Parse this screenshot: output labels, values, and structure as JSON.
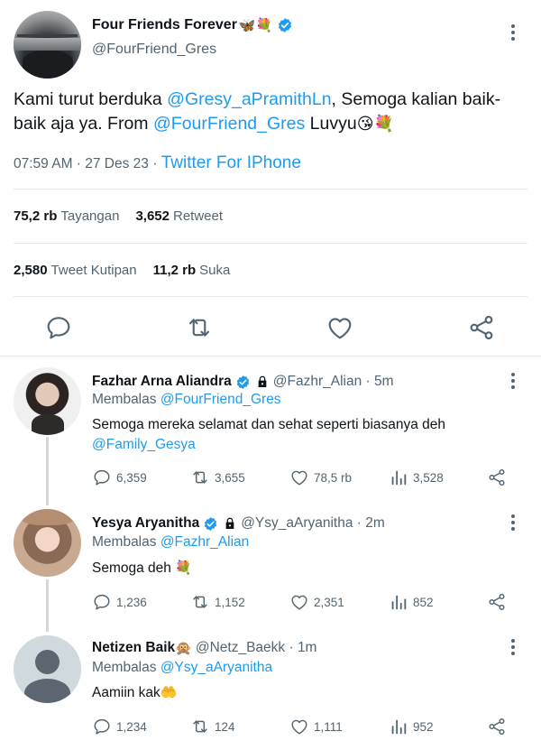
{
  "main_tweet": {
    "author_name": "Four Friends Forever",
    "author_emoji": "🦋💐",
    "handle": "@FourFriend_Gres",
    "text_part1": "Kami turut berduka ",
    "mention1": "@Gresy_aPramithLn",
    "text_part2": ", Semoga kalian baik-baik aja ya. From ",
    "mention2": "@FourFriend_Gres",
    "text_part3": " Luvyu",
    "text_emoji": "😘💐",
    "time": "07:59 AM · 27 Des 23 · ",
    "source": "Twitter For IPhone",
    "views_count": "75,2 rb",
    "views_label": "Tayangan",
    "retweets_count": "3,652",
    "retweets_label": "Retweet",
    "quotes_count": "2,580",
    "quotes_label": "Tweet Kutipan",
    "likes_count": "11,2 rb",
    "likes_label": "Suka"
  },
  "replies": [
    {
      "name": "Fazhar Arna Aliandra",
      "handle": "@Fazhr_Alian · 5m",
      "replying_label": "Membalas ",
      "replying_to": "@FourFriend_Gres",
      "text": "Semoga mereka selamat dan sehat seperti biasanya deh",
      "text_mention": "@Family_Gesya",
      "replies": "6,359",
      "retweets": "3,655",
      "likes": "78,5 rb",
      "views": "3,528"
    },
    {
      "name": "Yesya Aryanitha",
      "handle": "@Ysy_aAryanitha · 2m",
      "replying_label": "Membalas ",
      "replying_to": "@Fazhr_Alian",
      "text": "Semoga deh ",
      "text_emoji": "💐",
      "replies": "1,236",
      "retweets": "1,152",
      "likes": "2,351",
      "views": "852"
    },
    {
      "name": "Netizen Baik",
      "name_emoji": "🙊",
      "handle": "@Netz_Baekk · 1m",
      "replying_label": "Membalas ",
      "replying_to": "@Ysy_aAryanitha",
      "text": "Aamiin kak",
      "text_emoji": "🤲",
      "replies": "1,234",
      "retweets": "124",
      "likes": "1,111",
      "views": "952"
    }
  ],
  "colors": {
    "accent": "#1d9bf0",
    "muted": "#536471",
    "divider": "#e7eaec"
  },
  "icons": [
    "verified-badge-icon",
    "more-options-icon",
    "reply-icon",
    "retweet-icon",
    "like-icon",
    "share-icon",
    "lock-icon",
    "views-icon",
    "default-avatar-icon"
  ]
}
